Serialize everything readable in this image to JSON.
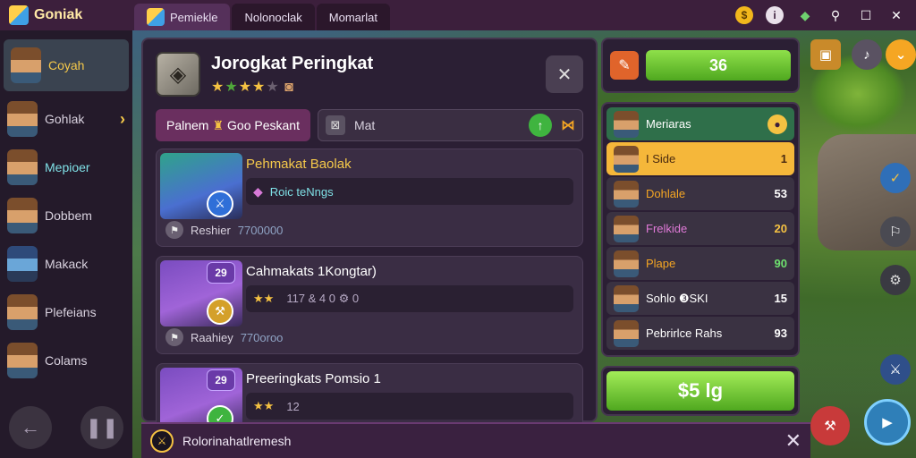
{
  "app": {
    "title": "Goniak"
  },
  "tabs": [
    {
      "label": "Pemiekle"
    },
    {
      "label": "Nolonoclak"
    },
    {
      "label": "Momarlat"
    }
  ],
  "window_controls": [
    "coin-icon",
    "info-icon",
    "gem-icon",
    "search-icon",
    "maximize-icon",
    "close-icon"
  ],
  "sidebar": {
    "items": [
      {
        "label": "Coyah"
      },
      {
        "label": "Gohlak"
      },
      {
        "label": "Mepioer"
      },
      {
        "label": "Dobbem"
      },
      {
        "label": "Makack"
      },
      {
        "label": "Plefeians"
      },
      {
        "label": "Colams"
      }
    ]
  },
  "panel": {
    "title": "Jorogkat Peringkat",
    "tab_label": "Palnem",
    "tab_label_2": "Goo Peskant",
    "search_value": "Mat",
    "cards": [
      {
        "name": "Pehmakat Baolak",
        "meta": "Roic teNngs",
        "foot_label": "Reshier",
        "foot_value": "7700000"
      },
      {
        "level": "29",
        "name": "Cahmakats 1Kongtar)",
        "meta": "117 & 4 0 ⚙ 0",
        "foot_label": "Raahiey",
        "foot_value": "770oroo"
      },
      {
        "level": "29",
        "name": "Preeringkats Pomsio 1",
        "meta": "12"
      }
    ]
  },
  "toast": {
    "text": "Rolorinahatlremesh"
  },
  "board": {
    "score": "36",
    "header": "Meriaras",
    "entries": [
      {
        "name": "I Side",
        "value": "1"
      },
      {
        "name": "Dohlale",
        "value": "53"
      },
      {
        "name": "Frelkide",
        "value": "20"
      },
      {
        "name": "Plape",
        "value": "90"
      },
      {
        "name": "Sohlo ❸SKI",
        "value": "15"
      },
      {
        "name": "Pebrirlce Rahs",
        "value": "93"
      }
    ],
    "button_label": "$5 lg"
  },
  "colors": {
    "topbar": "#3c1f3c",
    "panel": "#2b1f34",
    "accent_gold": "#f5c242",
    "accent_green": "#6fc73a",
    "active_tab": "#6a2f5f"
  }
}
